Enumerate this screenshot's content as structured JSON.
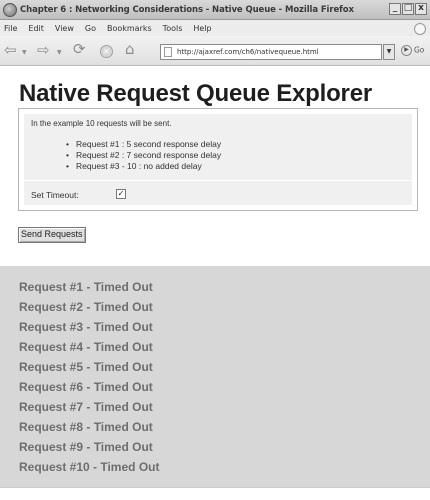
{
  "window": {
    "title": "Chapter 6 : Networking Considerations - Native Queue - Mozilla Firefox",
    "controls": {
      "minimize": "_",
      "maximize": "□",
      "close": "x"
    }
  },
  "menu": [
    "File",
    "Edit",
    "View",
    "Go",
    "Bookmarks",
    "Tools",
    "Help"
  ],
  "toolbar": {
    "url": "http://ajaxref.com/ch6/nativequeue.html",
    "go_label": "Go",
    "icons": [
      "back-arrow-icon",
      "forward-arrow-icon",
      "reload-icon",
      "stop-icon",
      "home-icon",
      "page-icon",
      "go-arrow-icon"
    ]
  },
  "page": {
    "title": "Native Request Queue Explorer",
    "intro": "In the example 10 requests will be sent.",
    "requests": [
      "Request #1 : 5 second response delay",
      "Request #2 : 7 second response delay",
      "Request #3 - 10 : no added delay"
    ],
    "timeout_label": "Set Timeout:",
    "timeout_checked": true,
    "send_button": "Send Requests",
    "results": [
      "Request #1 - Timed Out",
      "Request #2 - Timed Out",
      "Request #3 - Timed Out",
      "Request #4 - Timed Out",
      "Request #5 - Timed Out",
      "Request #6 - Timed Out",
      "Request #7 - Timed Out",
      "Request #8 - Timed Out",
      "Request #9 - Timed Out",
      "Request #10 - Timed Out"
    ]
  },
  "colors": {
    "results_background": "#d7d7d7",
    "results_text": "#6e6e6e",
    "config_background": "#f0f0f0"
  }
}
